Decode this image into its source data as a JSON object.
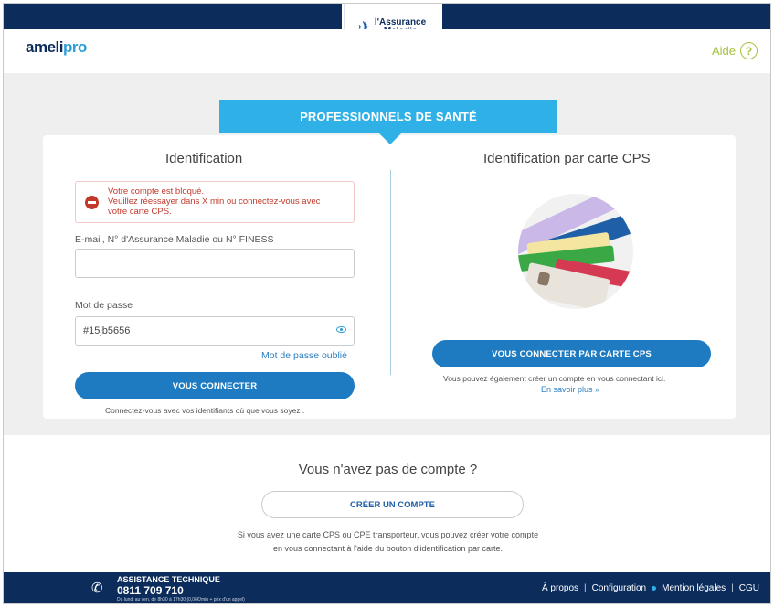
{
  "header": {
    "logo_line1": "l'Assurance",
    "logo_line2": "Maladie",
    "brand_part1": "ameli",
    "brand_part2": "pro",
    "help_label": "Aide",
    "help_icon_glyph": "?"
  },
  "banner": {
    "label": "PROFESSIONNELS DE SANTÉ"
  },
  "login": {
    "title": "Identification",
    "alert_lines": [
      "Votre compte est bloqué.",
      "Veuillez réessayer dans X min ou connectez-vous avec",
      "votre carte CPS."
    ],
    "email_label": "E-mail, N° d'Assurance Maladie ou N° FINESS",
    "email_value": "",
    "password_label": "Mot de passe",
    "password_value": "#15jb5656",
    "forgot_link": "Mot de passe oublié",
    "submit_label": "VOUS CONNECTER",
    "note": "Connectez-vous avec vos identifiants où que vous soyez ."
  },
  "cps": {
    "title": "Identification par carte CPS",
    "button_label": "VOUS CONNECTER PAR CARTE CPS",
    "note": "Vous pouvez également créer un compte en vous connectant ici.",
    "more_link": "En savoir plus »"
  },
  "signup": {
    "title": "Vous n'avez pas de compte ?",
    "button_label": "CRÉER UN COMPTE",
    "info_line1": "Si vous avez une carte CPS ou CPE transporteur, vous pouvez créer votre compte",
    "info_line2": "en vous connectant à l'aide du bouton d'identification par carte."
  },
  "footer": {
    "assist_title": "ASSISTANCE TECHNIQUE",
    "assist_phone": "0811 709 710",
    "assist_hours": "Du lundi au ven. de 8h30 à 17h30 (0,06€/min + prix d'un appel)",
    "links": [
      "À propos",
      "Configuration",
      "Mention légales",
      "CGU"
    ],
    "separator": "|"
  },
  "colors": {
    "navy": "#0c2d5c",
    "banner_blue": "#2fb0e6",
    "button_blue": "#1e7bc2",
    "alert_red": "#c0392b",
    "help_green": "#a5c23e"
  },
  "icons": [
    "assurance-maladie-emblem-icon",
    "help-icon",
    "blocked-icon",
    "eye-icon",
    "phone-icon",
    "bullet-dot-icon"
  ]
}
